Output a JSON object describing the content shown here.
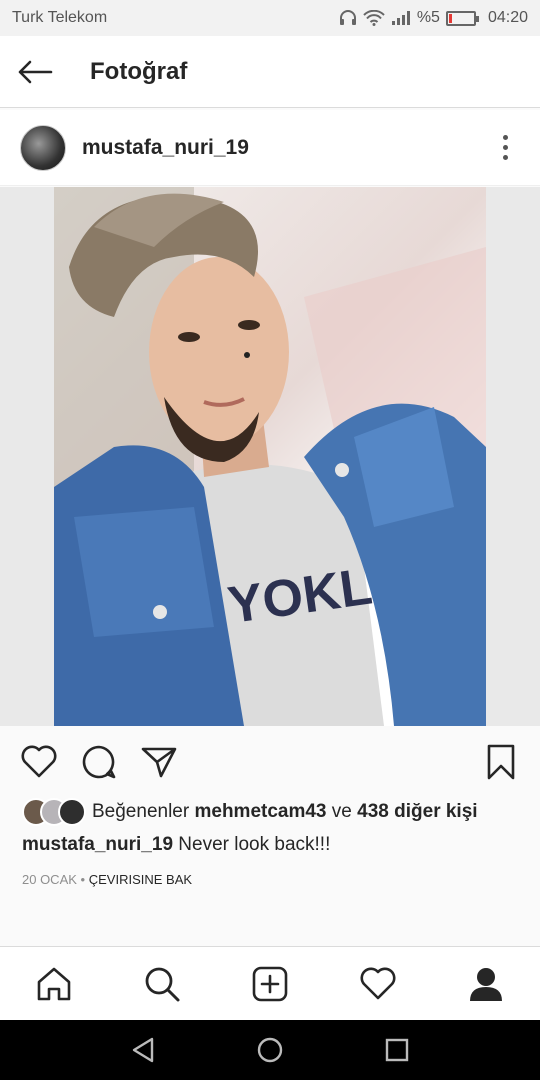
{
  "status": {
    "carrier": "Turk Telekom",
    "battery_text": "%5",
    "battery_level": 0.05,
    "time": "04:20"
  },
  "header": {
    "title": "Fotoğraf"
  },
  "post": {
    "username": "mustafa_nuri_19",
    "likes": {
      "prefix": "Beğenenler",
      "user": "mehmetcam43",
      "connector": "ve",
      "others": "438 diğer kişi"
    },
    "caption_user": "mustafa_nuri_19",
    "caption_text": "Never look back!!!",
    "date": "20 OCAK",
    "separator": "•",
    "translate": "ÇEVIRISINE BAK"
  },
  "colors": {
    "battery_low": "#e53935",
    "text": "#262626",
    "muted": "#8e8e8e"
  },
  "icons": {
    "back": "arrow-left-icon",
    "more": "more-vertical-icon",
    "like": "heart-icon",
    "comment": "comment-icon",
    "share": "send-icon",
    "save": "bookmark-icon",
    "home": "home-icon",
    "search": "search-icon",
    "add": "add-post-icon",
    "activity": "heart-icon",
    "profile": "profile-icon"
  }
}
